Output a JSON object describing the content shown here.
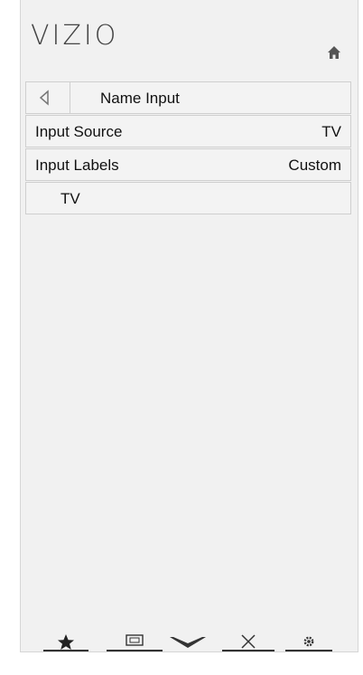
{
  "app": {
    "logo": "VIZIO"
  },
  "header": {
    "title": "Name Input"
  },
  "rows": [
    {
      "label": "Input Source",
      "value": "TV"
    },
    {
      "label": "Input Labels",
      "value": "Custom"
    },
    {
      "label": "TV",
      "value": ""
    }
  ],
  "bottom_bar": {
    "buttons": [
      {
        "icon": "star-icon"
      },
      {
        "icon": "wide-icon"
      },
      {
        "icon": "vizio-v-icon"
      },
      {
        "icon": "close-icon"
      },
      {
        "icon": "settings-icon"
      }
    ]
  },
  "colors": {
    "panel": "#f1f1f1",
    "border": "#cfcfcf",
    "text": "#111111"
  }
}
